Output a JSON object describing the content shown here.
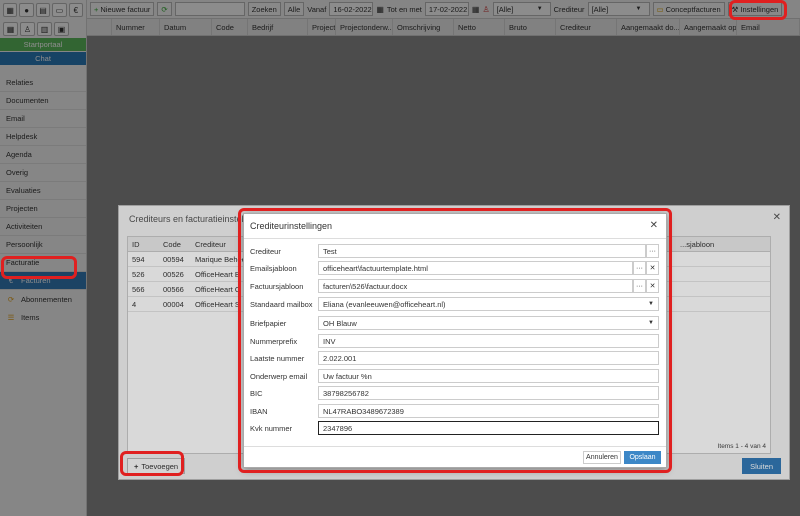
{
  "colors": {
    "accent": "#337ab7",
    "highlight": "#e02020",
    "green": "#5cb85c"
  },
  "sidebar": {
    "buttons": [
      {
        "label": "Startportaal",
        "color": "green"
      },
      {
        "label": "Chat",
        "color": "blue"
      }
    ],
    "items": [
      {
        "label": "Relaties"
      },
      {
        "label": "Documenten"
      },
      {
        "label": "Email"
      },
      {
        "label": "Helpdesk"
      },
      {
        "label": "Agenda"
      },
      {
        "label": "Overig"
      },
      {
        "label": "Evaluaties"
      },
      {
        "label": "Projecten"
      },
      {
        "label": "Activiteiten"
      },
      {
        "label": "Persoonlijk"
      },
      {
        "label": "Facturatie"
      },
      {
        "label": "Facturen",
        "icon": "euro-icon"
      },
      {
        "label": "Abonnementen",
        "icon": "cycle-icon"
      },
      {
        "label": "Items",
        "icon": "list-icon"
      }
    ]
  },
  "toolbar": {
    "new_invoice": "Nieuwe factuur",
    "search": "Zoeken",
    "all": "Alle",
    "from_label": "Vanaf",
    "from_date": "16-02-2022",
    "to_label": "Tot en met",
    "to_date": "17-02-2022",
    "user_filter": "[Alle]",
    "creditor_label": "Crediteur",
    "creditor_filter": "[Alle]",
    "concept_invoices": "Conceptfacturen",
    "settings": "Instellingen"
  },
  "grid": {
    "columns": [
      "Nummer",
      "Datum",
      "Code",
      "Bedrijf",
      "Project",
      "Projectonderw...",
      "Omschrijving",
      "Netto",
      "Bruto",
      "Crediteur",
      "Aangemaakt do...",
      "Aangemaakt op",
      "Email"
    ]
  },
  "mid_dialog": {
    "title": "Crediteurs en facturatieinstellingen",
    "columns": [
      "ID",
      "Code",
      "Crediteur",
      "...sjabloon"
    ],
    "rows": [
      {
        "id": "594",
        "code": "00594",
        "creditor": "Marique Beheer"
      },
      {
        "id": "526",
        "code": "00526",
        "creditor": "OfficeHeart B"
      },
      {
        "id": "566",
        "code": "00566",
        "creditor": "OfficeHeart G"
      },
      {
        "id": "4",
        "code": "00004",
        "creditor": "OfficeHeart S"
      }
    ],
    "footer": "Items 1 - 4 van 4",
    "add_button": "Toevoegen",
    "close_button": "Sluiten"
  },
  "modal": {
    "title": "Crediteurinstellingen",
    "fields": {
      "creditor": {
        "label": "Crediteur",
        "value": "Test"
      },
      "email_template": {
        "label": "Emailsjabloon",
        "value": "officeheart\\factuurtemplate.html"
      },
      "invoice_template": {
        "label": "Factuursjabloon",
        "value": "facturen\\526\\factuur.docx"
      },
      "default_mailbox": {
        "label": "Standaard mailbox",
        "value": "Eliana (evanleeuwen@officeheart.nl)"
      },
      "letterhead": {
        "label": "Briefpapier",
        "value": "OH Blauw"
      },
      "number_prefix": {
        "label": "Nummerprefix",
        "value": "INV"
      },
      "last_number": {
        "label": "Laatste nummer",
        "value": "2.022.001"
      },
      "email_subject": {
        "label": "Onderwerp email",
        "value": "Uw factuur %n"
      },
      "bic": {
        "label": "BIC",
        "value": "38798256782"
      },
      "iban": {
        "label": "IBAN",
        "value": "NL47RABO3489672389"
      },
      "kvk": {
        "label": "Kvk nummer",
        "value": "2347896"
      }
    },
    "cancel": "Annuleren",
    "save": "Opslaan"
  }
}
